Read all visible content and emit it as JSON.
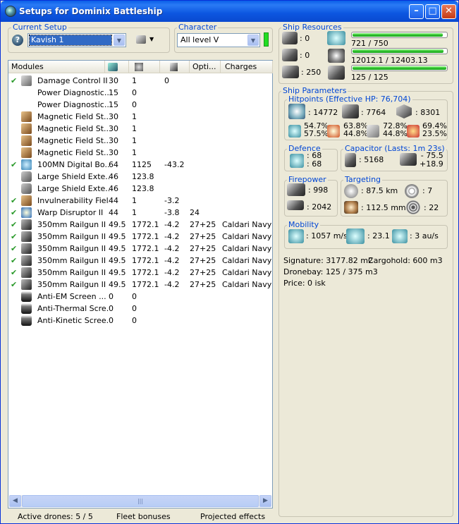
{
  "window": {
    "title": "Setups for Dominix Battleship"
  },
  "current_setup": {
    "legend": "Current Setup",
    "value": "Kavish 1"
  },
  "character": {
    "legend": "Character",
    "value": "All level V"
  },
  "modules": {
    "columns": [
      "Modules",
      "",
      "",
      "",
      "Opti...",
      "Charges"
    ],
    "rows": [
      {
        "check": "✔",
        "icon": "damage-control-icon",
        "name": "Damage Control II",
        "c1": "30",
        "c2": "1",
        "c3": "0",
        "c4": "",
        "charges": ""
      },
      {
        "check": "",
        "icon": "power-diagnostic-icon",
        "name": "Power Diagnostic...",
        "c1": "15",
        "c2": "0",
        "c3": "",
        "c4": "",
        "charges": ""
      },
      {
        "check": "",
        "icon": "power-diagnostic-icon",
        "name": "Power Diagnostic...",
        "c1": "15",
        "c2": "0",
        "c3": "",
        "c4": "",
        "charges": ""
      },
      {
        "check": "",
        "icon": "magnetic-field-icon",
        "name": "Magnetic Field St...",
        "c1": "30",
        "c2": "1",
        "c3": "",
        "c4": "",
        "charges": ""
      },
      {
        "check": "",
        "icon": "magnetic-field-icon",
        "name": "Magnetic Field St...",
        "c1": "30",
        "c2": "1",
        "c3": "",
        "c4": "",
        "charges": ""
      },
      {
        "check": "",
        "icon": "magnetic-field-icon",
        "name": "Magnetic Field St...",
        "c1": "30",
        "c2": "1",
        "c3": "",
        "c4": "",
        "charges": ""
      },
      {
        "check": "",
        "icon": "magnetic-field-icon",
        "name": "Magnetic Field St...",
        "c1": "30",
        "c2": "1",
        "c3": "",
        "c4": "",
        "charges": ""
      },
      {
        "check": "✔",
        "icon": "microwarpdrive-icon",
        "name": "100MN Digital Bo...",
        "c1": "64",
        "c2": "1125",
        "c3": "-43.2",
        "c4": "",
        "charges": ""
      },
      {
        "check": "",
        "icon": "shield-extender-icon",
        "name": "Large Shield Exte...",
        "c1": "46",
        "c2": "123.8",
        "c3": "",
        "c4": "",
        "charges": ""
      },
      {
        "check": "",
        "icon": "shield-extender-icon",
        "name": "Large Shield Exte...",
        "c1": "46",
        "c2": "123.8",
        "c3": "",
        "c4": "",
        "charges": ""
      },
      {
        "check": "✔",
        "icon": "invulnerability-field-icon",
        "name": "Invulnerability Fiel...",
        "c1": "44",
        "c2": "1",
        "c3": "-3.2",
        "c4": "",
        "charges": ""
      },
      {
        "check": "✔",
        "icon": "warp-disruptor-icon",
        "name": "Warp Disruptor II",
        "c1": "44",
        "c2": "1",
        "c3": "-3.8",
        "c4": "24",
        "charges": ""
      },
      {
        "check": "✔",
        "icon": "railgun-icon",
        "name": "350mm Railgun II",
        "c1": "49.5",
        "c2": "1772.1",
        "c3": "-4.2",
        "c4": "27+25",
        "charges": "Caldari Navy A"
      },
      {
        "check": "✔",
        "icon": "railgun-icon",
        "name": "350mm Railgun II",
        "c1": "49.5",
        "c2": "1772.1",
        "c3": "-4.2",
        "c4": "27+25",
        "charges": "Caldari Navy A"
      },
      {
        "check": "✔",
        "icon": "railgun-icon",
        "name": "350mm Railgun II",
        "c1": "49.5",
        "c2": "1772.1",
        "c3": "-4.2",
        "c4": "27+25",
        "charges": "Caldari Navy A"
      },
      {
        "check": "✔",
        "icon": "railgun-icon",
        "name": "350mm Railgun II",
        "c1": "49.5",
        "c2": "1772.1",
        "c3": "-4.2",
        "c4": "27+25",
        "charges": "Caldari Navy A"
      },
      {
        "check": "✔",
        "icon": "railgun-icon",
        "name": "350mm Railgun II",
        "c1": "49.5",
        "c2": "1772.1",
        "c3": "-4.2",
        "c4": "27+25",
        "charges": "Caldari Navy A"
      },
      {
        "check": "✔",
        "icon": "railgun-icon",
        "name": "350mm Railgun II",
        "c1": "49.5",
        "c2": "1772.1",
        "c3": "-4.2",
        "c4": "27+25",
        "charges": "Caldari Navy A"
      },
      {
        "check": "",
        "icon": "anti-em-rig-icon",
        "name": "Anti-EM Screen ...",
        "c1": "0",
        "c2": "0",
        "c3": "",
        "c4": "",
        "charges": ""
      },
      {
        "check": "",
        "icon": "anti-thermal-rig-icon",
        "name": "Anti-Thermal Scre...",
        "c1": "0",
        "c2": "0",
        "c3": "",
        "c4": "",
        "charges": ""
      },
      {
        "check": "",
        "icon": "anti-kinetic-rig-icon",
        "name": "Anti-Kinetic Scree...",
        "c1": "0",
        "c2": "0",
        "c3": "",
        "c4": "",
        "charges": ""
      }
    ]
  },
  "status_bar": {
    "drones": "Active drones: 5 / 5",
    "fleet": "Fleet bonuses",
    "projected": "Projected effects"
  },
  "ship_resources": {
    "legend": "Ship Resources",
    "turrets": ": 0",
    "launchers": ": 0",
    "calibration": ": 250",
    "cpu": {
      "text": "721 / 750",
      "fraction": 0.961
    },
    "powergrid": {
      "text": "12012.1 / 12403.13",
      "fraction": 0.968
    },
    "dronebw": {
      "text": "125 / 125",
      "fraction": 1.0
    }
  },
  "ship_parameters": {
    "legend": "Ship Parameters",
    "hitpoints": {
      "legend": "Hitpoints (Effective HP: 76,704)",
      "shield": ": 14772",
      "armor": ": 7764",
      "structure": ": 8301",
      "res_shield": [
        "54.7%",
        "57.5%"
      ],
      "res_armor": [
        "63.8%",
        "44.8%"
      ],
      "res_kin": [
        "72.8%",
        "44.8%"
      ],
      "res_exp": [
        "69.4%",
        "23.5%"
      ]
    },
    "defence": {
      "legend": "Defence",
      "a": ": 68",
      "b": ": 68"
    },
    "capacitor": {
      "legend": "Capacitor (Lasts: 1m 23s)",
      "amount": ": 5168",
      "delta_neg": "- 75.5",
      "delta_pos": "+18.9"
    },
    "firepower": {
      "legend": "Firepower",
      "turret_dps": ": 998",
      "volley": ": 2042"
    },
    "targeting": {
      "legend": "Targeting",
      "range": ": 87.5 km",
      "targets": ": 7",
      "scan_res": ": 112.5 mm",
      "sensor": ": 22"
    },
    "mobility": {
      "legend": "Mobility",
      "speed": ": 1057 m/s",
      "align": ": 23.1 s",
      "warp": ": 3 au/s"
    },
    "signature": "Signature: 3177.82 m2",
    "cargohold": "Cargohold: 600 m3",
    "dronebay": "Dronebay: 125 / 375 m3",
    "price": "Price: 0 isk"
  }
}
